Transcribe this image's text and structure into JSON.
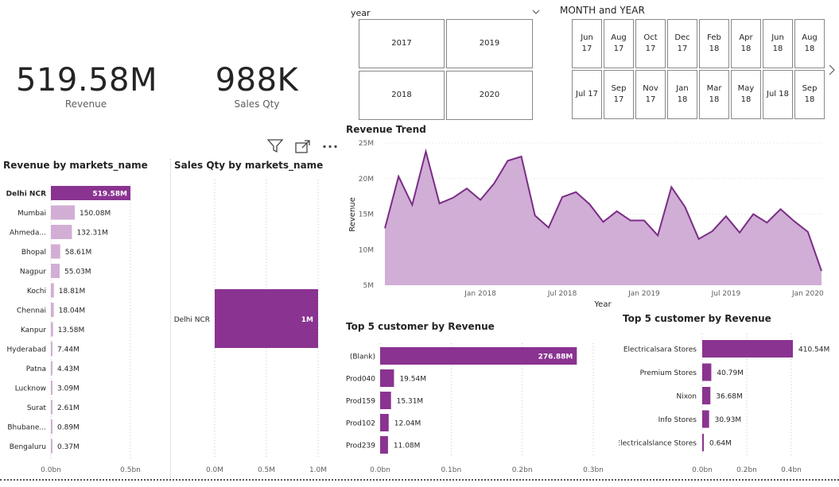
{
  "kpis": {
    "revenue": {
      "value": "519.58M",
      "label": "Revenue"
    },
    "sales_qty": {
      "value": "988K",
      "label": "Sales Qty"
    }
  },
  "year_slicer": {
    "title": "year",
    "tiles": [
      "2017",
      "2019",
      "2018",
      "2020"
    ]
  },
  "month_slicer": {
    "title": "MONTH  and YEAR",
    "row1": [
      "Jun\n17",
      "Aug\n17",
      "Oct\n17",
      "Dec\n17",
      "Feb\n18",
      "Apr\n18",
      "Jun\n18",
      "Aug\n18"
    ],
    "row2": [
      "Jul 17",
      "Sep\n17",
      "Nov\n17",
      "Jan\n18",
      "Mar\n18",
      "May\n18",
      "Jul 18",
      "Sep\n18"
    ]
  },
  "visual_header": {
    "filter_icon": "filter-icon",
    "focus_icon": "focus-mode-icon",
    "more_icon": "more-options-icon"
  },
  "revenue_by_market": {
    "title": "Revenue by markets_name",
    "chart_data": {
      "type": "bar",
      "orientation": "horizontal",
      "categories": [
        "Delhi NCR",
        "Mumbai",
        "Ahmeda...",
        "Bhopal",
        "Nagpur",
        "Kochi",
        "Chennai",
        "Kanpur",
        "Hyderabad",
        "Patna",
        "Lucknow",
        "Surat",
        "Bhubane...",
        "Bengaluru"
      ],
      "values": [
        519.58,
        150.08,
        132.31,
        58.61,
        55.03,
        18.81,
        18.04,
        13.58,
        7.44,
        4.43,
        3.09,
        2.61,
        0.89,
        0.37
      ],
      "data_labels": [
        "519.58M",
        "150.08M",
        "132.31M",
        "58.61M",
        "55.03M",
        "18.81M",
        "18.04M",
        "13.58M",
        "7.44M",
        "4.43M",
        "3.09M",
        "2.61M",
        "0.89M",
        "0.37M"
      ],
      "xticks": [
        "0.0bn",
        "0.5bn"
      ],
      "xlim": [
        0,
        500
      ],
      "unit": "M",
      "highlighted": "Delhi NCR",
      "colors": {
        "highlight": "#8a3391",
        "dim": "#d2aed5"
      }
    }
  },
  "sales_qty_by_market": {
    "title": "Sales Qty by markets_name",
    "chart_data": {
      "type": "bar",
      "orientation": "horizontal",
      "categories": [
        "Delhi NCR"
      ],
      "values": [
        1.0
      ],
      "data_labels": [
        "1M"
      ],
      "xticks": [
        "0.0M",
        "0.5M",
        "1.0M"
      ],
      "xlim": [
        0,
        1.0
      ],
      "unit": "M",
      "color": "#8a3391"
    }
  },
  "revenue_trend": {
    "title": "Revenue Trend",
    "chart_data": {
      "type": "area",
      "xlabel": "Year",
      "ylabel": "Revenue",
      "x": [
        "2017-06",
        "2017-07",
        "2017-08",
        "2017-09",
        "2017-10",
        "2017-11",
        "2017-12",
        "2018-01",
        "2018-02",
        "2018-03",
        "2018-04",
        "2018-05",
        "2018-06",
        "2018-07",
        "2018-08",
        "2018-09",
        "2018-10",
        "2018-11",
        "2018-12",
        "2019-01",
        "2019-02",
        "2019-03",
        "2019-04",
        "2019-05",
        "2019-06",
        "2019-07",
        "2019-08",
        "2019-09",
        "2019-10",
        "2019-11",
        "2019-12",
        "2020-01",
        "2020-02",
        "2020-03",
        "2020-04",
        "2020-05",
        "2020-06"
      ],
      "y": [
        13.0,
        20.3,
        16.3,
        23.8,
        16.5,
        17.3,
        18.6,
        17.0,
        19.3,
        22.5,
        23.1,
        14.8,
        13.1,
        17.4,
        18.1,
        16.4,
        13.9,
        15.4,
        14.1,
        14.1,
        12.0,
        18.8,
        16.0,
        11.5,
        12.6,
        14.7,
        12.4,
        15.0,
        13.8,
        15.7,
        14.0,
        12.5,
        7.0
      ],
      "ylim": [
        5,
        25
      ],
      "yticks": [
        "5M",
        "10M",
        "15M",
        "20M",
        "25M"
      ],
      "xticks": [
        "Jan 2018",
        "Jul 2018",
        "Jan 2019",
        "Jul 2019",
        "Jan 2020"
      ],
      "colors": {
        "line": "#7b2d86",
        "fill": "#d0aed6"
      }
    }
  },
  "top5_left": {
    "title": "Top 5 customer by Revenue",
    "chart_data": {
      "type": "bar",
      "orientation": "horizontal",
      "categories": [
        "(Blank)",
        "Prod040",
        "Prod159",
        "Prod102",
        "Prod239"
      ],
      "values": [
        276.88,
        19.54,
        15.31,
        12.04,
        11.08
      ],
      "data_labels": [
        "276.88M",
        "19.54M",
        "15.31M",
        "12.04M",
        "11.08M"
      ],
      "xticks": [
        "0.0bn",
        "0.1bn",
        "0.2bn",
        "0.3bn"
      ],
      "xlim": [
        0,
        300
      ],
      "color": "#8a3391"
    }
  },
  "top5_right": {
    "title": "Top 5 customer by Revenue",
    "chart_data": {
      "type": "bar",
      "orientation": "horizontal",
      "categories": [
        "Electricalsara Stores",
        "Premium Stores",
        "Nixon",
        "Info Stores",
        "Electricalslance Stores"
      ],
      "values": [
        410.54,
        40.79,
        36.68,
        30.93,
        0.64
      ],
      "data_labels": [
        "410.54M",
        "40.79M",
        "36.68M",
        "30.93M",
        "0.64M"
      ],
      "xticks": [
        "0.0bn",
        "0.2bn",
        "0.4bn"
      ],
      "xlim": [
        0,
        400
      ],
      "color": "#8a3391"
    }
  }
}
